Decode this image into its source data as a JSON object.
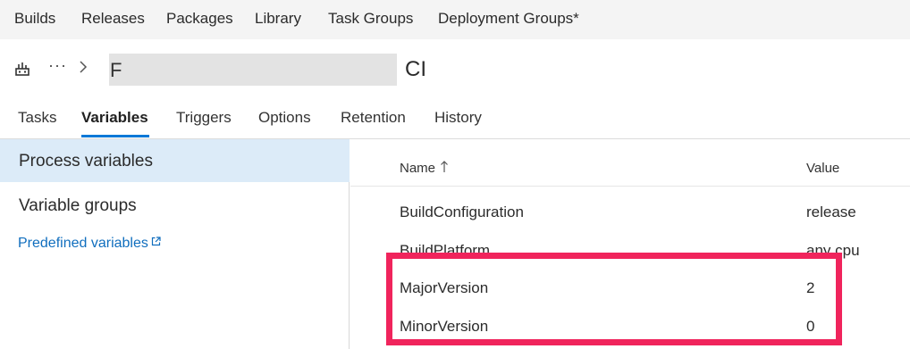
{
  "hub_nav": {
    "items": [
      {
        "label": "Builds"
      },
      {
        "label": "Releases"
      },
      {
        "label": "Packages"
      },
      {
        "label": "Library"
      },
      {
        "label": "Task Groups"
      },
      {
        "label": "Deployment Groups*"
      }
    ]
  },
  "title_bar": {
    "ellipsis": "···",
    "definition_name_initial": "F",
    "definition_name_suffix": "CI",
    "definition_icon": "build-definition-icon"
  },
  "tabs": [
    {
      "label": "Tasks",
      "active": false
    },
    {
      "label": "Variables",
      "active": true
    },
    {
      "label": "Triggers",
      "active": false
    },
    {
      "label": "Options",
      "active": false
    },
    {
      "label": "Retention",
      "active": false
    },
    {
      "label": "History",
      "active": false
    }
  ],
  "left_panel": {
    "process_variables": "Process variables",
    "variable_groups": "Variable groups",
    "predefined_variables": "Predefined variables"
  },
  "variables_grid": {
    "columns": {
      "name": "Name",
      "value": "Value"
    },
    "sort_icon": "arrow-up-icon",
    "rows": [
      {
        "name": "BuildConfiguration",
        "value": "release"
      },
      {
        "name": "BuildPlatform",
        "value": "any cpu"
      },
      {
        "name": "MajorVersion",
        "value": "2"
      },
      {
        "name": "MinorVersion",
        "value": "0"
      }
    ]
  },
  "colors": {
    "accent": "#0078d7",
    "selection": "#dcebf8",
    "link": "#106ebe",
    "highlight_border": "#f0245c",
    "hub_background": "#f4f4f4"
  }
}
